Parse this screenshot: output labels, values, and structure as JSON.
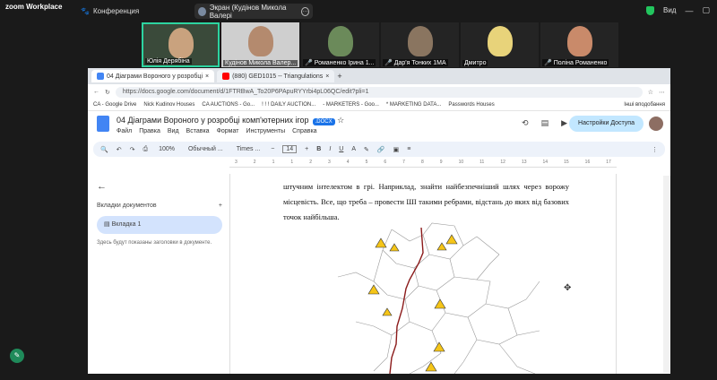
{
  "zoom": {
    "app_title": "zoom Workplace",
    "conference_label": "Конференция",
    "share_label": "Экран (Кудінов Микола Валері",
    "view_label": "Вид"
  },
  "participants": [
    {
      "name": "Юлія Дерябіна",
      "muted": false
    },
    {
      "name": "Кудінов Микола Валер...",
      "muted": false
    },
    {
      "name": "Романенко Ірина 1...",
      "muted": true
    },
    {
      "name": "Дар'я Тонких 1МА",
      "muted": true
    },
    {
      "name": "Дмитро",
      "muted": false
    },
    {
      "name": "Поліна Романенко",
      "muted": true
    }
  ],
  "browser": {
    "tabs": [
      {
        "label": "04 Діаграми Вороного у розробці",
        "active": true
      },
      {
        "label": "(880) GED1015 -- Triangulations",
        "active": false
      }
    ],
    "url": "https://docs.google.com/document/d/1FTRBwA_To20P6PApuRYYrbi4pL06QC/edit?pli=1",
    "bookmarks": [
      "CA - Google Drive",
      "Nick Kudinov Houses",
      "CA AUCTIONS - Go...",
      "! ! ! DAILY AUCTION...",
      "- MARKETERS - Goo...",
      "* MARKETING DATA...",
      "Passwords Houses",
      "Інші вподобання"
    ]
  },
  "doc": {
    "title": "04 Діаграми Вороного у розробці комп'ютерних ігор",
    "badge": ".DOCX",
    "menu": [
      "Файл",
      "Правка",
      "Вид",
      "Вставка",
      "Формат",
      "Инструменты",
      "Справка"
    ],
    "share_button": "Настройки Доступа",
    "toolbar": {
      "zoom": "100%",
      "style": "Обычный ...",
      "font": "Times ...",
      "size": "14"
    },
    "sidebar": {
      "tabs_heading": "Вкладки документов",
      "tab1": "Вкладка 1",
      "hint": "Здесь будут показаны заголовки в документе."
    },
    "body_text": "штучним інтелектом в грі. Наприклад, знайти найбезпечніший шлях через ворожу місцевість. Все, що треба – провести ШІ такими ребрами, відстань до яких від базових точок найбільша."
  },
  "colors": {
    "zoom_bg": "#1a1a1a",
    "accent": "#1a73e8",
    "path_red": "#8b1a1a",
    "hazard_yellow": "#f5c518"
  }
}
